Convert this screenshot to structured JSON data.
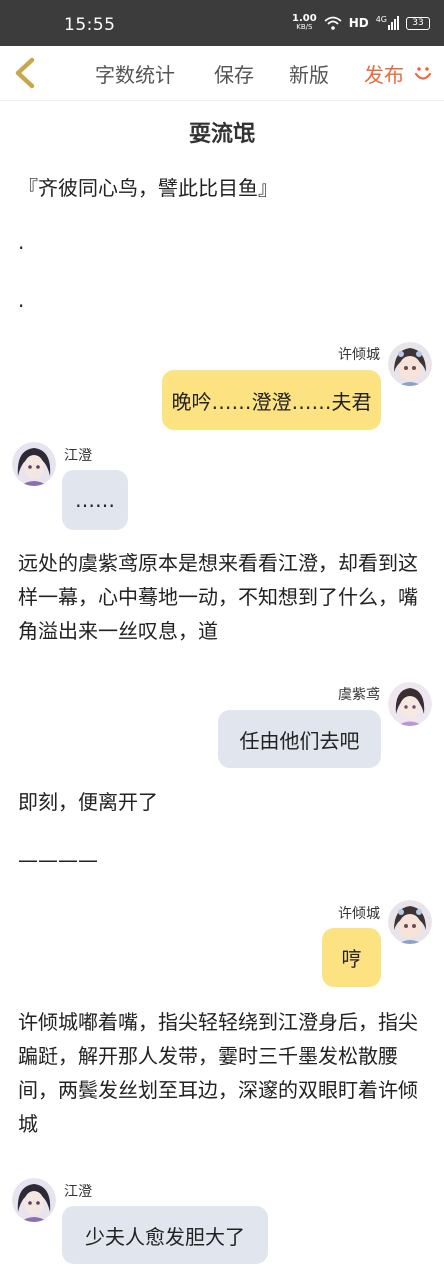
{
  "status_bar": {
    "time": "15:55",
    "net_speed_value": "1.00",
    "net_speed_unit": "KB/S",
    "hd_label": "HD",
    "signal_label": "4G",
    "battery_level": "33"
  },
  "toolbar": {
    "word_count": "字数统计",
    "save": "保存",
    "new_version": "新版",
    "publish": "发布"
  },
  "document": {
    "title": "耍流氓",
    "blocks": [
      "『齐彼同心鸟，譬此比目鱼』",
      ".",
      ".",
      "远处的虞紫鸢原本是想来看看江澄，却看到这样一幕，心中蓦地一动，不知想到了什么，嘴角溢出来一丝叹息，道",
      "即刻，便离开了",
      "————",
      "许倾城嘟着嘴，指尖轻轻绕到江澄身后，指尖蹁跹，解开那人发带，霎时三千墨发松散腰间，两鬓发丝划至耳边，深邃的双眼盯着许倾城"
    ],
    "messages": [
      {
        "speaker": "许倾城",
        "text": "晚吟……澄澄……夫君"
      },
      {
        "speaker": "江澄",
        "text": "……"
      },
      {
        "speaker": "虞紫鸢",
        "text": "任由他们去吧"
      },
      {
        "speaker": "许倾城",
        "text": "哼"
      },
      {
        "speaker": "江澄",
        "text": "少夫人愈发胆大了"
      }
    ]
  },
  "colors": {
    "accent": "#ea6a3a",
    "back_arrow": "#c9a84a",
    "bubble_yellow": "#fde282",
    "bubble_grey": "#e1e6ee",
    "status_bar": "#3c3c3c"
  }
}
